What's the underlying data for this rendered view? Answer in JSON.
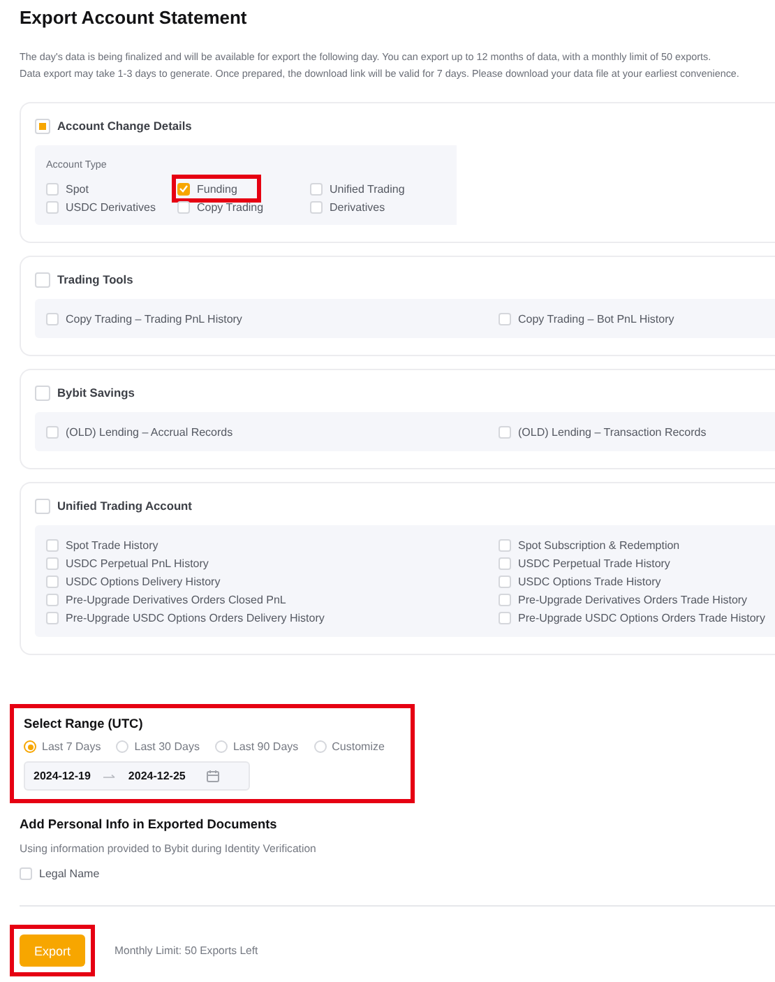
{
  "title": "Export Account Statement",
  "description": [
    "The day's data is being finalized and will be available for export the following day. You can export up to 12 months of data, with a monthly limit of 50 exports.",
    "Data export may take 1-3 days to generate. Once prepared, the download link will be valid for 7 days. Please download your data file at your earliest convenience."
  ],
  "sections": [
    {
      "kind": "grid",
      "title": "Account Change Details",
      "checked": false,
      "indeterminate": true,
      "subtitle": "Account Type",
      "options": [
        {
          "label": "Spot",
          "checked": false,
          "highlighted": false
        },
        {
          "label": "Funding",
          "checked": true,
          "highlighted": true
        },
        {
          "label": "Unified Trading",
          "checked": false,
          "highlighted": false
        },
        {
          "label": "USDC Derivatives",
          "checked": false,
          "highlighted": false
        },
        {
          "label": "Copy Trading",
          "checked": false,
          "highlighted": false
        },
        {
          "label": "Derivatives",
          "checked": false,
          "highlighted": false
        }
      ]
    },
    {
      "kind": "columns",
      "title": "Trading Tools",
      "checked": false,
      "indeterminate": false,
      "options": [
        {
          "label": "Copy Trading – Trading PnL History",
          "checked": false
        },
        {
          "label": "Copy Trading – Bot PnL History",
          "checked": false
        }
      ]
    },
    {
      "kind": "columns",
      "title": "Bybit Savings",
      "checked": false,
      "indeterminate": false,
      "options": [
        {
          "label": "(OLD) Lending – Accrual Records",
          "checked": false
        },
        {
          "label": "(OLD) Lending – Transaction Records",
          "checked": false
        }
      ]
    },
    {
      "kind": "columns",
      "title": "Unified Trading Account",
      "checked": false,
      "indeterminate": false,
      "options": [
        {
          "label": "Spot Trade History",
          "checked": false
        },
        {
          "label": "Spot Subscription & Redemption",
          "checked": false
        },
        {
          "label": "USDC Perpetual PnL History",
          "checked": false
        },
        {
          "label": "USDC Perpetual Trade History",
          "checked": false
        },
        {
          "label": "USDC Options Delivery History",
          "checked": false
        },
        {
          "label": "USDC Options Trade History",
          "checked": false
        },
        {
          "label": "Pre-Upgrade Derivatives Orders Closed PnL",
          "checked": false
        },
        {
          "label": "Pre-Upgrade Derivatives Orders Trade History",
          "checked": false
        },
        {
          "label": "Pre-Upgrade USDC Options Orders Delivery History",
          "checked": false
        },
        {
          "label": "Pre-Upgrade USDC Options Orders Trade History",
          "checked": false
        }
      ]
    }
  ],
  "range": {
    "title": "Select Range (UTC)",
    "highlighted": true,
    "options": [
      {
        "label": "Last 7 Days",
        "selected": true
      },
      {
        "label": "Last 30 Days",
        "selected": false
      },
      {
        "label": "Last 90 Days",
        "selected": false
      },
      {
        "label": "Customize",
        "selected": false
      }
    ],
    "start": "2024-12-19",
    "end": "2024-12-25"
  },
  "personal": {
    "title": "Add Personal Info in Exported Documents",
    "note": "Using information provided to Bybit during Identity Verification",
    "options": [
      {
        "label": "Legal Name",
        "checked": false
      }
    ]
  },
  "footer": {
    "button": "Export",
    "highlighted": true,
    "limit": "Monthly Limit: 50 Exports Left"
  }
}
